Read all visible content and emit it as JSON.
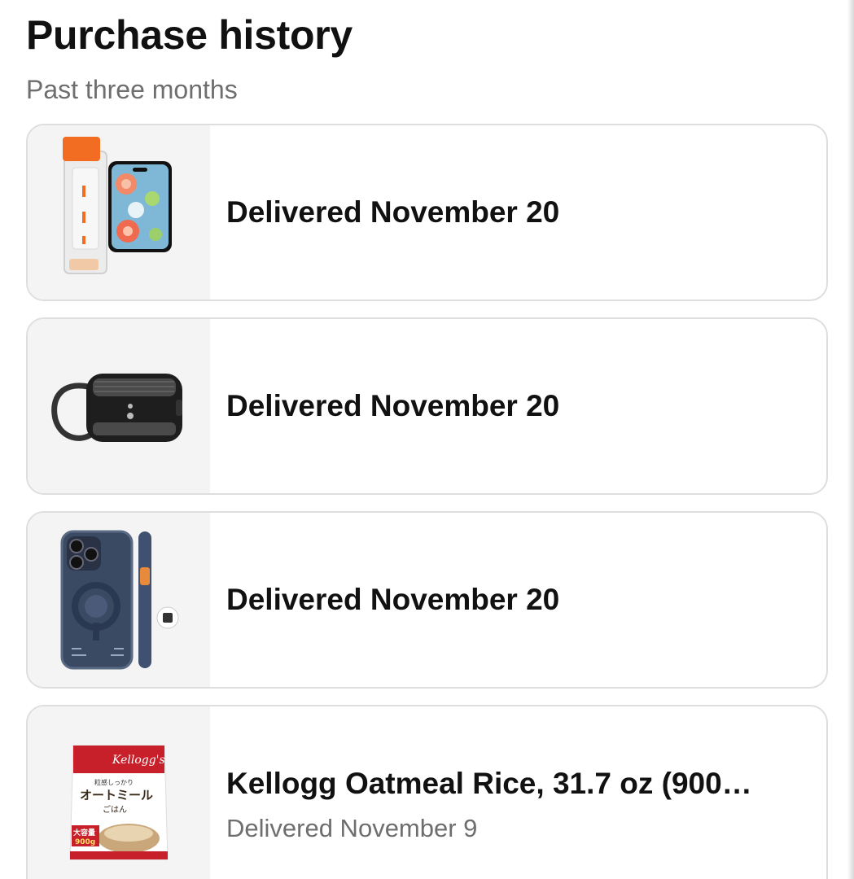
{
  "header": {
    "title": "Purchase history",
    "subtitle": "Past three months"
  },
  "orders": [
    {
      "title": "Delivered November 20",
      "status": "",
      "image_icon": "screen-protector-icon"
    },
    {
      "title": "Delivered November 20",
      "status": "",
      "image_icon": "earbuds-case-icon"
    },
    {
      "title": "Delivered November 20",
      "status": "",
      "image_icon": "phone-case-icon"
    },
    {
      "title": "Kellogg Oatmeal Rice, 31.7 oz (900…",
      "status": "Delivered November 9",
      "image_icon": "oatmeal-package-icon"
    }
  ],
  "product_art": {
    "screen_protector_brand": "",
    "oatmeal_brand": "Kellogg's",
    "oatmeal_jp_top": "粒感しっかり",
    "oatmeal_jp_name": "オートミール",
    "oatmeal_jp_sub": "ごはん",
    "oatmeal_badge": "大容量",
    "oatmeal_weight": "900g"
  },
  "colors": {
    "title": "#111111",
    "subtitle": "#6e6e6e",
    "card_border": "#dedede",
    "thumb_bg": "#f4f4f4"
  }
}
